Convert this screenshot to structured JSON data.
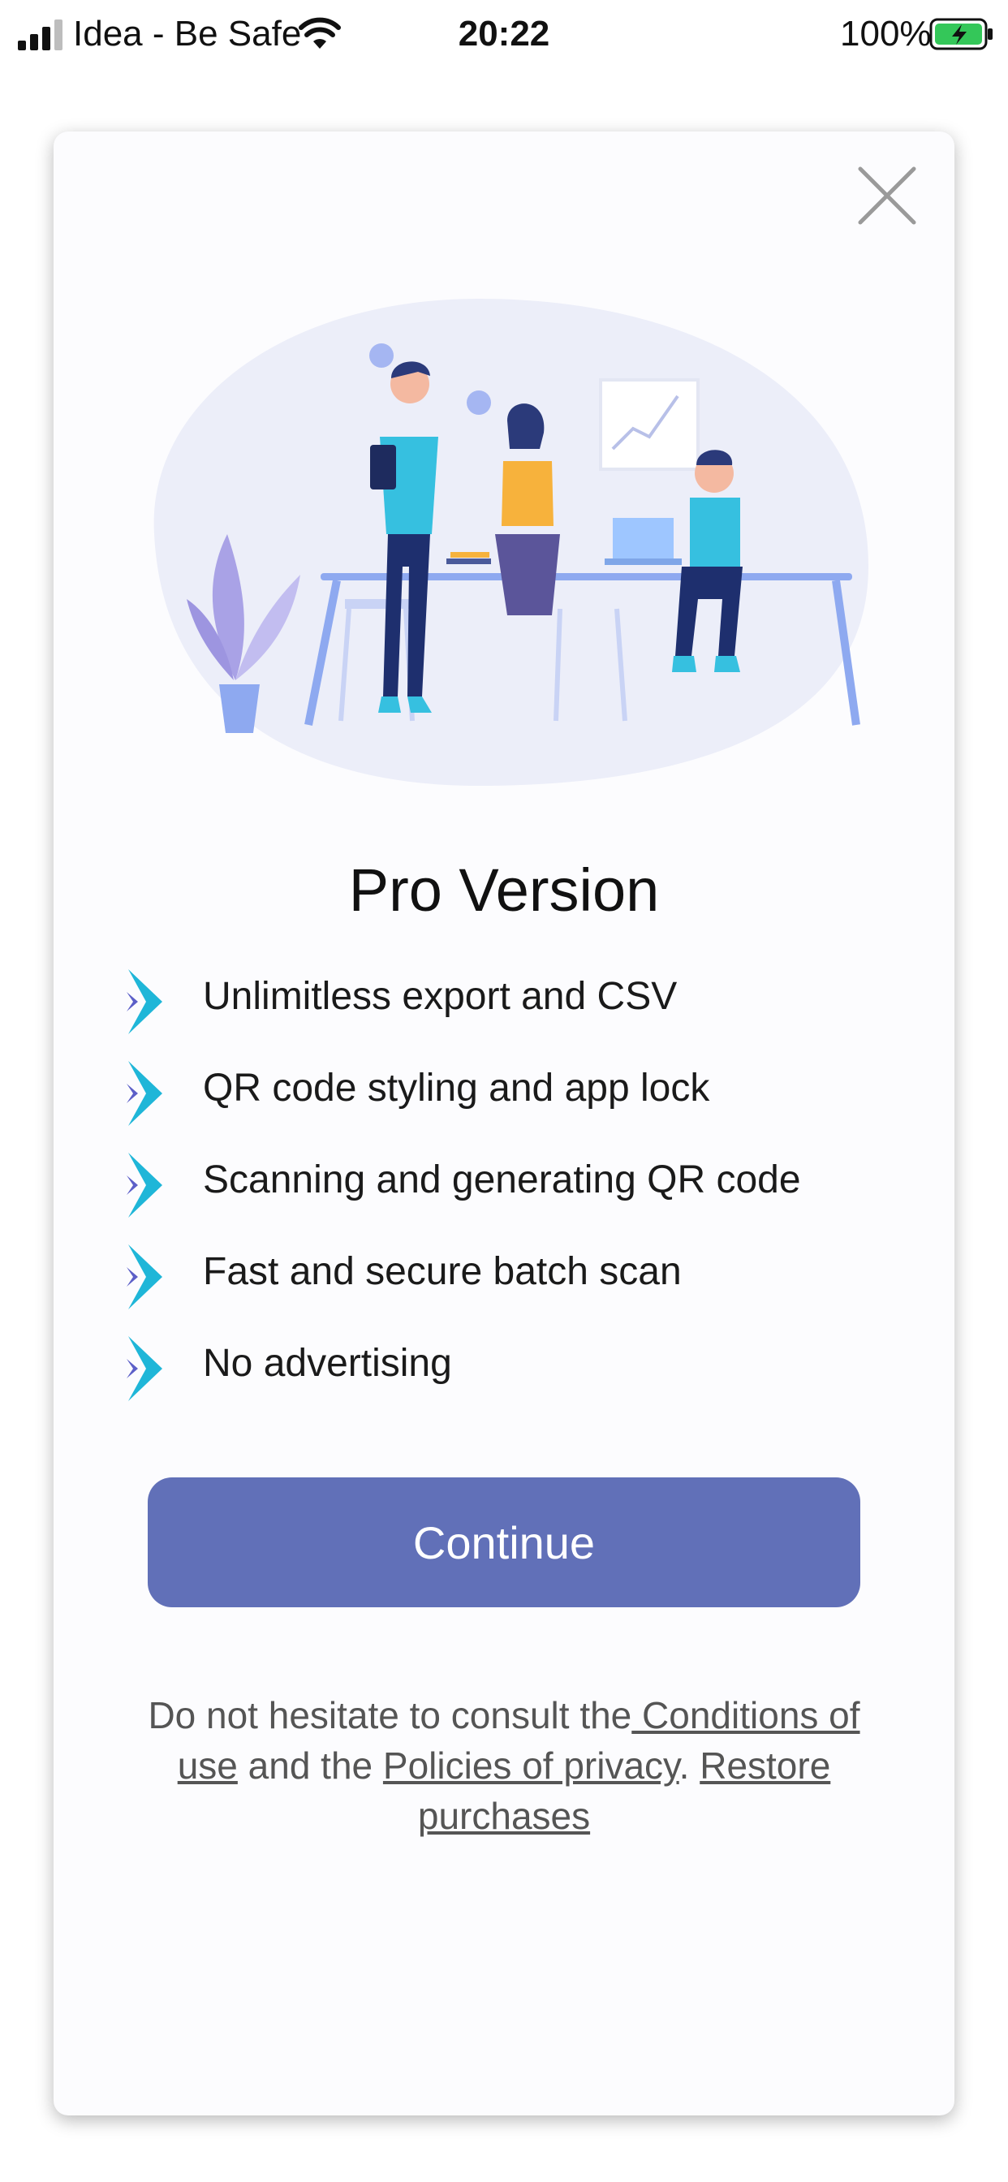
{
  "status_bar": {
    "carrier": "Idea - Be Safe",
    "time": "20:22",
    "battery_percent": "100%",
    "signal_icon": "signal-bars-icon",
    "wifi_icon": "wifi-icon",
    "battery_icon": "battery-charging-icon",
    "battery_color": "#34c759"
  },
  "dialog": {
    "close_icon": "close-icon",
    "title": "Pro Version",
    "features": [
      {
        "label": "Unlimitless export and CSV",
        "icon": "chevron-bullet-icon"
      },
      {
        "label": "QR code styling and app lock",
        "icon": "chevron-bullet-icon"
      },
      {
        "label": "Scanning and generating QR code",
        "icon": "chevron-bullet-icon"
      },
      {
        "label": "Fast and secure batch scan",
        "icon": "chevron-bullet-icon"
      },
      {
        "label": "No advertising",
        "icon": "chevron-bullet-icon"
      }
    ],
    "continue_label": "Continue",
    "legal": {
      "prefix": "Do not hesitate to consult the",
      "conditions_link": " Conditions of use",
      "middle": " and the ",
      "privacy_link": "Policies of privacy",
      "separator": ". ",
      "restore_link": "Restore purchases"
    }
  },
  "colors": {
    "accent_button": "#6170b8",
    "bullet_cyan": "#1fb6d8",
    "bullet_purple": "#5c5fc8",
    "illustration_blob": "#eceef9"
  }
}
